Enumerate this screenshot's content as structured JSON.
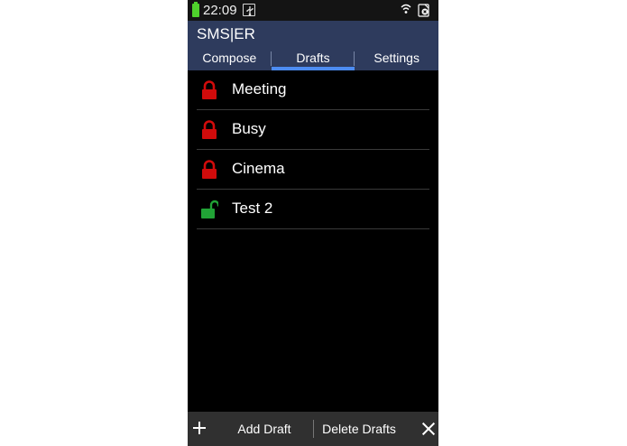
{
  "status_bar": {
    "time": "22:09",
    "battery_color": "#4fd12c"
  },
  "app": {
    "title": "SMS|ER"
  },
  "tabs": [
    {
      "label": "Compose",
      "active": false
    },
    {
      "label": "Drafts",
      "active": true
    },
    {
      "label": "Settings",
      "active": false
    }
  ],
  "drafts": [
    {
      "label": "Meeting",
      "locked": true
    },
    {
      "label": "Busy",
      "locked": true
    },
    {
      "label": "Cinema",
      "locked": true
    },
    {
      "label": "Test 2",
      "locked": false
    }
  ],
  "bottom_bar": {
    "add_label": "Add Draft",
    "delete_label": "Delete Drafts"
  },
  "colors": {
    "accent": "#4d8cf2",
    "action_bar": "#2e3b5d",
    "lock_locked": "#d10b0b",
    "lock_unlocked": "#21a336"
  },
  "icons": {
    "locked": "locked-padlock-icon",
    "unlocked": "unlocked-padlock-icon",
    "add": "plus-icon",
    "close": "close-icon"
  }
}
